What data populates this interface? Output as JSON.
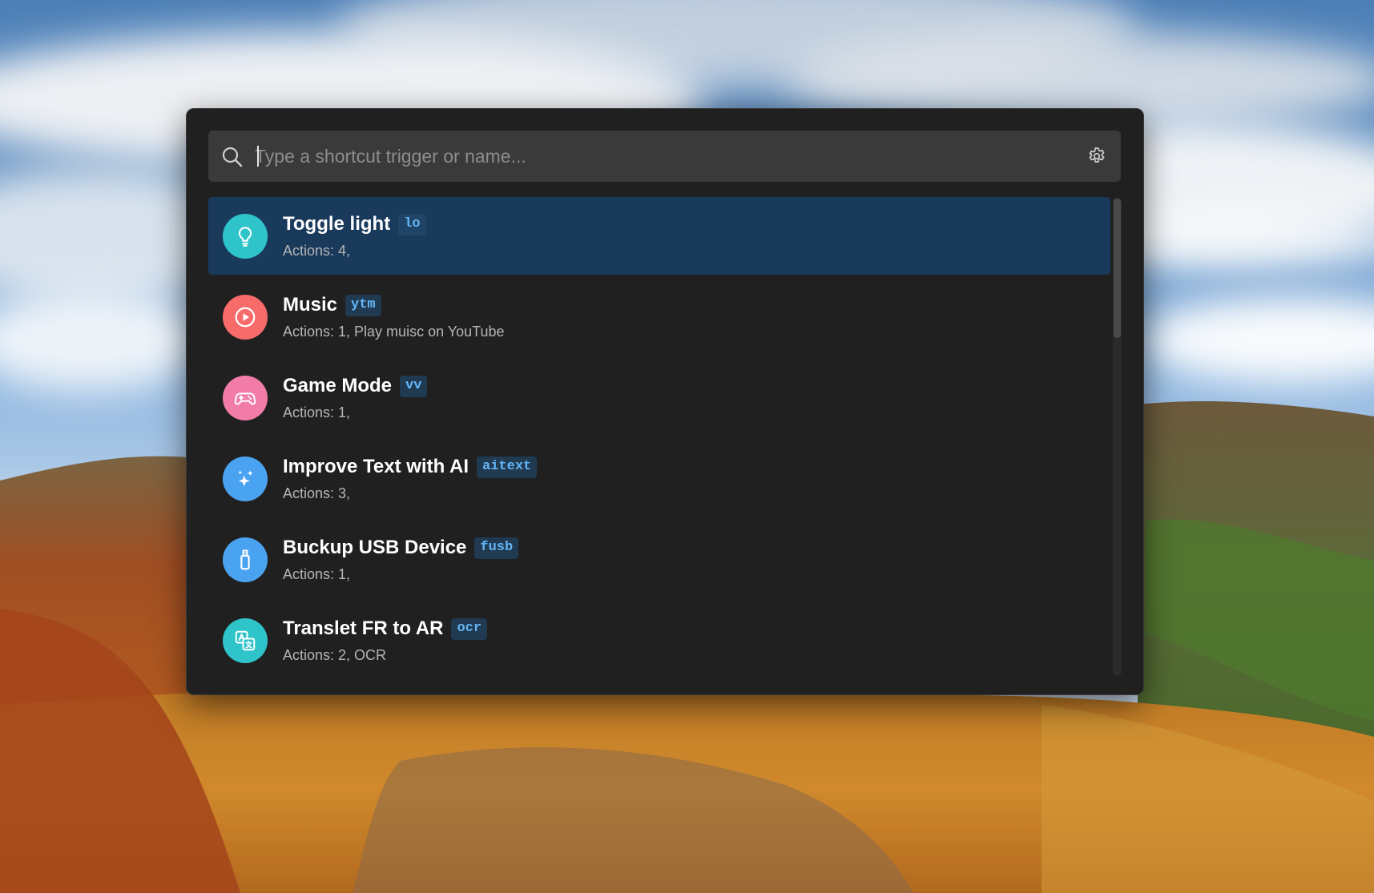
{
  "search": {
    "placeholder": "Type a shortcut trigger or name...",
    "value": ""
  },
  "colors": {
    "window_bg": "#202020",
    "search_bg": "#3a3a3a",
    "selected_bg": "#1a3a5c",
    "badge_text": "#64b5f6",
    "badge_bg": "#203a52"
  },
  "shortcuts": [
    {
      "title": "Toggle light",
      "trigger": "lo",
      "subtitle": "Actions: 4,",
      "icon": "lightbulb-icon",
      "icon_color": "#2ec4c9",
      "selected": true
    },
    {
      "title": "Music",
      "trigger": "ytm",
      "subtitle": "Actions: 1, Play muisc on YouTube",
      "icon": "play-circle-icon",
      "icon_color": "#f76b6b",
      "selected": false
    },
    {
      "title": "Game Mode",
      "trigger": "vv",
      "subtitle": "Actions: 1,",
      "icon": "gamepad-icon",
      "icon_color": "#f27ca8",
      "selected": false
    },
    {
      "title": "Improve Text with AI",
      "trigger": "aitext",
      "subtitle": "Actions: 3,",
      "icon": "sparkles-icon",
      "icon_color": "#4aa3f0",
      "selected": false
    },
    {
      "title": "Buckup USB Device",
      "trigger": "fusb",
      "subtitle": "Actions: 1,",
      "icon": "usb-drive-icon",
      "icon_color": "#4aa3f0",
      "selected": false
    },
    {
      "title": "Translet FR to AR",
      "trigger": "ocr",
      "subtitle": "Actions: 2, OCR",
      "icon": "translate-icon",
      "icon_color": "#2ec4c9",
      "selected": false
    }
  ]
}
